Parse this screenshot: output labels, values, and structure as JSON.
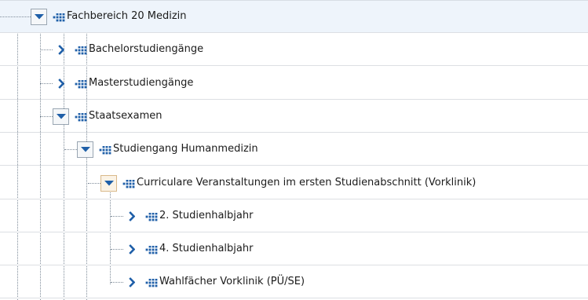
{
  "tree": {
    "nodes": [
      {
        "label": "Fachbereich 20 Medizin",
        "state": "expanded",
        "depth": 0
      },
      {
        "label": "Bachelorstudiengänge",
        "state": "collapsed",
        "depth": 1
      },
      {
        "label": "Masterstudiengänge",
        "state": "collapsed",
        "depth": 1
      },
      {
        "label": "Staatsexamen",
        "state": "expanded",
        "depth": 1
      },
      {
        "label": "Studiengang Humanmedizin",
        "state": "expanded",
        "depth": 2
      },
      {
        "label": "Curriculare Veranstaltungen im ersten Studienabschnitt (Vorklinik)",
        "state": "expanded",
        "depth": 3
      },
      {
        "label": "2. Studienhalbjahr",
        "state": "collapsed",
        "depth": 4
      },
      {
        "label": "4. Studienhalbjahr",
        "state": "collapsed",
        "depth": 4
      },
      {
        "label": "Wahlfächer Vorklinik (PÜ/SE)",
        "state": "collapsed",
        "depth": 4
      }
    ]
  },
  "icons": {
    "expanded": "chevron-down-icon",
    "collapsed": "chevron-right-icon",
    "node": "org-unit-icon"
  },
  "colors": {
    "chevron": "#1f5fa8",
    "node_icon": "#1f5fa8",
    "selected_row": "#eef4fb",
    "highlight_toggle": "#fbf3e6"
  }
}
